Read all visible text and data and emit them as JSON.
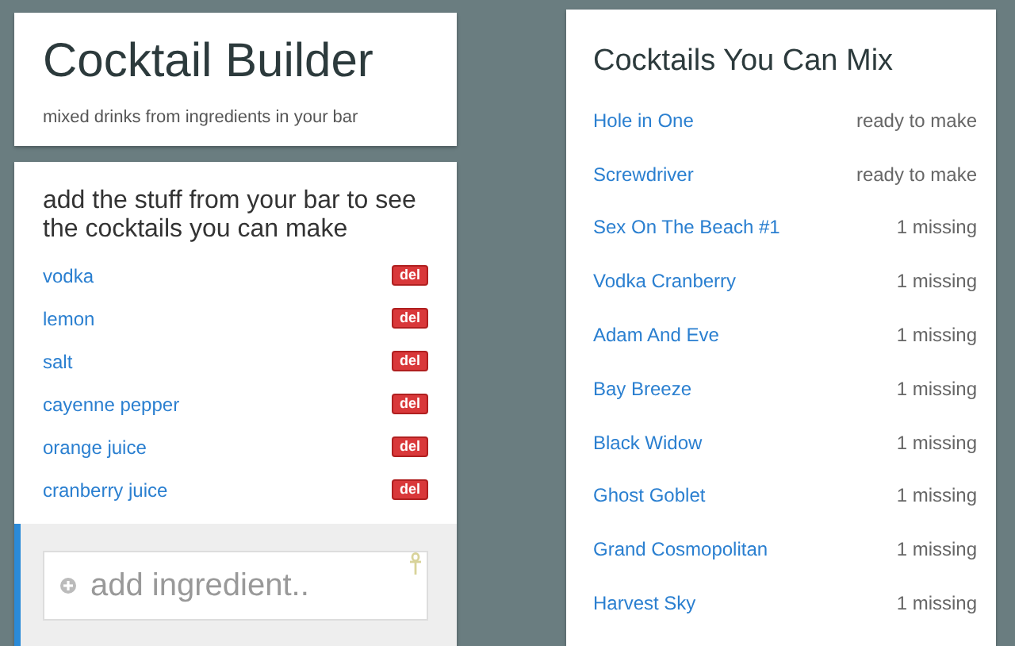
{
  "header": {
    "title": "Cocktail Builder",
    "subtitle": "mixed drinks from ingredients in your bar"
  },
  "ingredients": {
    "heading": "add the stuff from your bar to see the cocktails you can make",
    "items": [
      {
        "name": "vodka",
        "action": "del"
      },
      {
        "name": "lemon",
        "action": "del"
      },
      {
        "name": "salt",
        "action": "del"
      },
      {
        "name": "cayenne pepper",
        "action": "del"
      },
      {
        "name": "orange juice",
        "action": "del"
      },
      {
        "name": "cranberry juice",
        "action": "del"
      }
    ],
    "input": {
      "placeholder": "add ingredient.."
    }
  },
  "cocktails": {
    "heading": "Cocktails You Can Mix",
    "items": [
      {
        "name": "Hole in One",
        "status": "ready to make"
      },
      {
        "name": "Screwdriver",
        "status": "ready to make"
      },
      {
        "name": "Sex On The Beach #1",
        "status": "1 missing"
      },
      {
        "name": "Vodka Cranberry",
        "status": "1 missing"
      },
      {
        "name": "Adam And Eve",
        "status": "1 missing"
      },
      {
        "name": "Bay Breeze",
        "status": "1 missing"
      },
      {
        "name": "Black Widow",
        "status": "1 missing"
      },
      {
        "name": "Ghost Goblet",
        "status": "1 missing"
      },
      {
        "name": "Grand Cosmopolitan",
        "status": "1 missing"
      },
      {
        "name": "Harvest Sky",
        "status": "1 missing"
      }
    ]
  }
}
